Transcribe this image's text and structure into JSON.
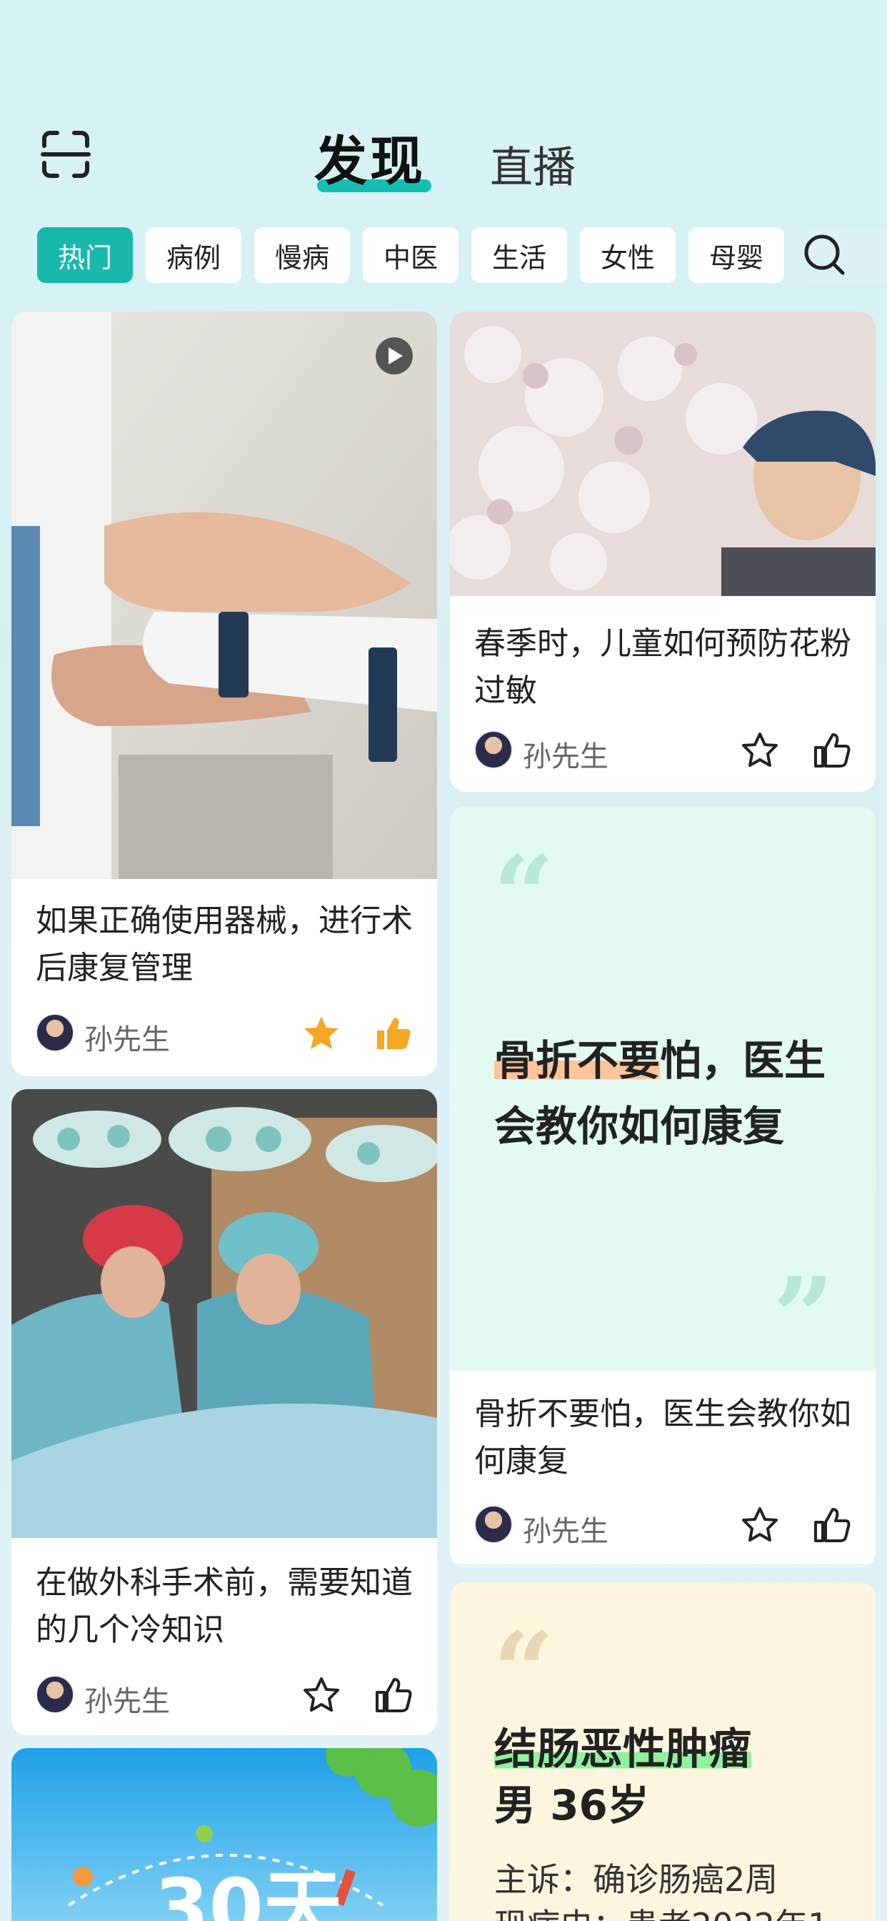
{
  "header": {
    "tab_active": "发现",
    "tab_other": "直播"
  },
  "categories": [
    "热门",
    "病例",
    "慢病",
    "中医",
    "生活",
    "女性",
    "母婴"
  ],
  "colors": {
    "accent": "#18b8ad",
    "quote_bg": "#e2faf1",
    "case_bg": "#fdf6df",
    "like_active": "#f5a623"
  },
  "cards": [
    {
      "title": "如果正确使用器械，进行术后康复管理",
      "author": "孙先生",
      "starred": true,
      "liked": true,
      "video": true
    },
    {
      "title": "春季时，儿童如何预防花粉过敏",
      "author": "孙先生",
      "starred": false,
      "liked": false
    },
    {
      "quote": "骨折不要怕，医生会教你如何康复",
      "title": "骨折不要怕，医生会教你如何康复",
      "author": "孙先生",
      "starred": false,
      "liked": false
    },
    {
      "title": "在做外科手术前，需要知道的几个冷知识",
      "author": "孙先生",
      "starred": false,
      "liked": false
    },
    {
      "case_title": "结肠恶性肿瘤",
      "case_sub": "男 36岁",
      "chief_complaint": "主诉：确诊肠癌2周",
      "history": "现病史：患者2022年1"
    },
    {
      "banner": "30天"
    }
  ]
}
